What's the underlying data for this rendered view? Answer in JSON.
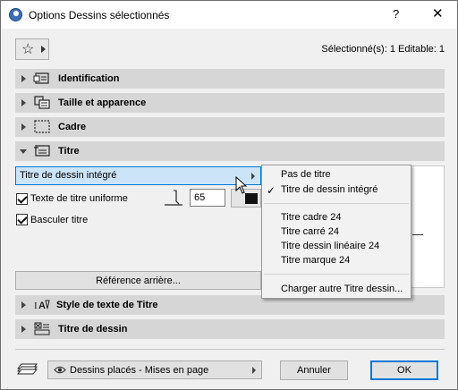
{
  "window": {
    "title": "Options Dessins sélectionnés",
    "help": "?",
    "close": "✕"
  },
  "toolbar": {
    "selection_info": "Sélectionné(s): 1 Editable: 1"
  },
  "panels": [
    {
      "label": "Identification",
      "icon": "id-card-icon"
    },
    {
      "label": "Taille et apparence",
      "icon": "size-appearance-icon"
    },
    {
      "label": "Cadre",
      "icon": "frame-icon"
    },
    {
      "label": "Titre",
      "icon": "title-icon"
    },
    {
      "label": "Style de texte de Titre",
      "icon": "text-style-icon"
    },
    {
      "label": "Titre de dessin",
      "icon": "drawing-title-icon"
    }
  ],
  "title_panel": {
    "title_type": "Titre de dessin intégré",
    "uniform_text_label": "Texte de titre uniforme",
    "uniform_text_checked": true,
    "font_size": "65",
    "color": "#111111",
    "flip_label": "Basculer titre",
    "flip_checked": true,
    "backref_button": "Référence arrière..."
  },
  "menu": {
    "items_top": [
      "Pas de titre",
      "Titre de dessin intégré"
    ],
    "checked_index": 1,
    "items_mid": [
      "Titre cadre 24",
      "Titre carré 24",
      "Titre dessin linéaire 24",
      "Titre marque 24"
    ],
    "items_bottom": [
      "Charger autre Titre dessin..."
    ]
  },
  "footer": {
    "view_option": "Dessins placés - Mises en page",
    "cancel": "Annuler",
    "ok": "OK"
  }
}
